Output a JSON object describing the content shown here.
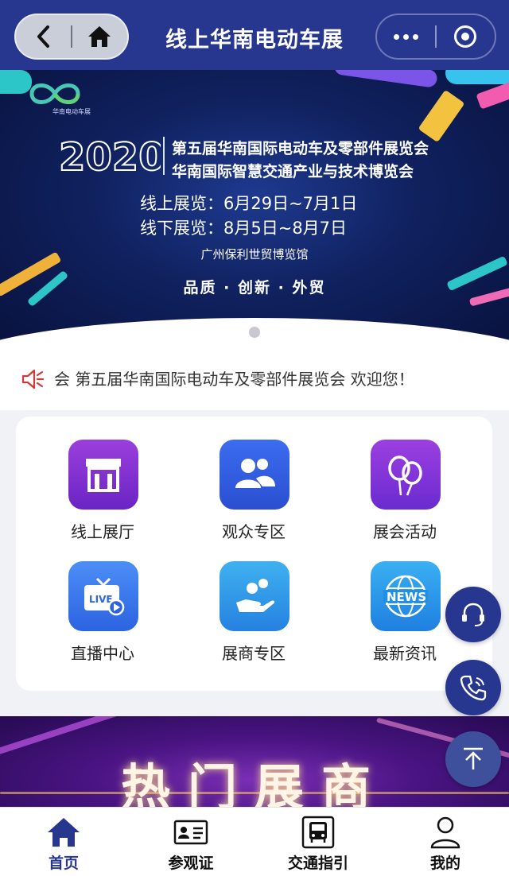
{
  "header": {
    "title": "线上华南电动车展",
    "back_icon": "chevron-left-icon",
    "home_icon": "home-icon",
    "more_icon": "more-dots-icon",
    "close_icon": "target-icon"
  },
  "banner": {
    "logo_text": "华南电动车展",
    "year": "2020",
    "title_line1": "第五届华南国际电动车及零部件展览会",
    "title_line2": "华南国际智慧交通产业与技术博览会",
    "online_dates": "线上展览：6月29日~7月1日",
    "offline_dates": "线下展览：8月5日~8月7日",
    "venue": "广州保利世贸博览馆",
    "slogan": "品质 · 创新 · 外贸"
  },
  "notice": {
    "icon": "speaker-icon",
    "text": "会  第五届华南国际电动车及零部件展览会 欢迎您！"
  },
  "grid": [
    {
      "label": "线上展厅",
      "icon": "exhibition-hall-icon",
      "color_top": "#9b3fdc",
      "color_bottom": "#6a24c4"
    },
    {
      "label": "观众专区",
      "icon": "audience-icon",
      "color_top": "#3c6cf0",
      "color_bottom": "#2a4fd0"
    },
    {
      "label": "展会活动",
      "icon": "balloons-icon",
      "color_top": "#9c3fe0",
      "color_bottom": "#6a2bd0"
    },
    {
      "label": "直播中心",
      "icon": "live-tv-icon",
      "color_top": "#4c8ef7",
      "color_bottom": "#2c63e0"
    },
    {
      "label": "展商专区",
      "icon": "exhibitor-hand-icon",
      "color_top": "#3fb1f0",
      "color_bottom": "#2581e0"
    },
    {
      "label": "最新资讯",
      "icon": "news-globe-icon",
      "color_top": "#3ab0f2",
      "color_bottom": "#1f7fe0"
    }
  ],
  "floating": {
    "service_icon": "headset-icon",
    "phone_icon": "phone-icon",
    "top_icon": "back-to-top-icon"
  },
  "hot_section": {
    "title": "热门展商"
  },
  "tabbar": [
    {
      "label": "首页",
      "icon": "home-tab-icon",
      "active": true
    },
    {
      "label": "参观证",
      "icon": "id-card-icon",
      "active": false
    },
    {
      "label": "交通指引",
      "icon": "bus-icon",
      "active": false
    },
    {
      "label": "我的",
      "icon": "user-icon",
      "active": false
    }
  ],
  "colors": {
    "brand": "#27368f",
    "active_tab": "#27368f"
  }
}
